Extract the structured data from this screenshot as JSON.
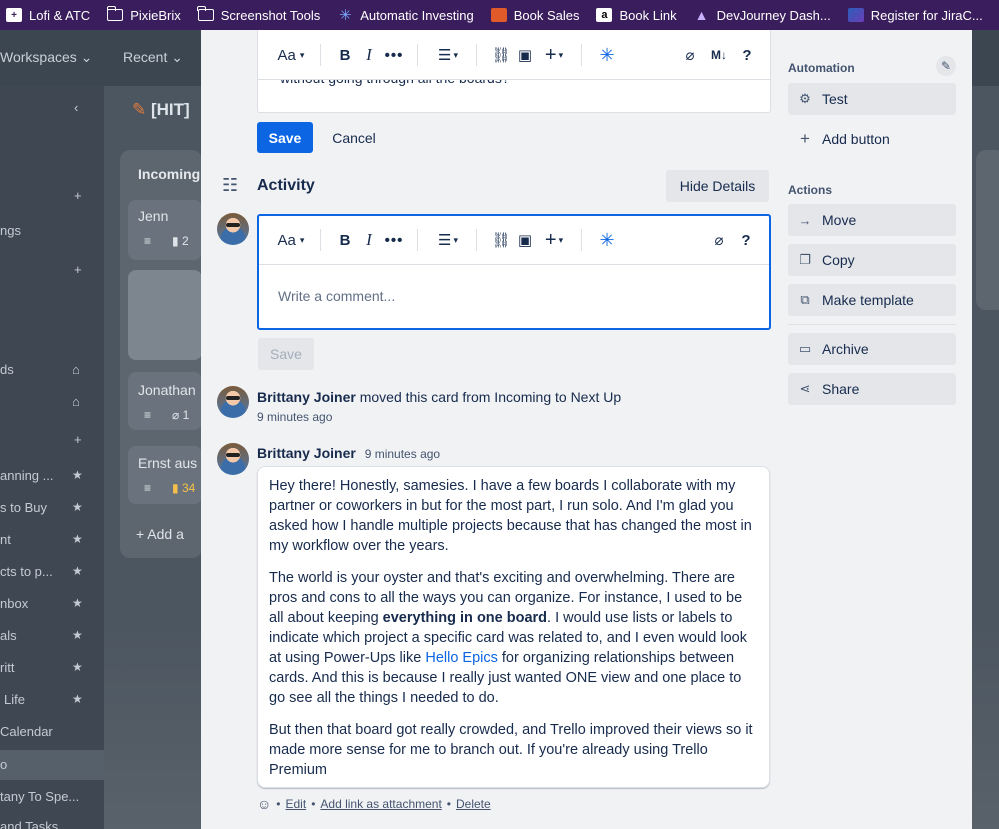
{
  "bookmarks": [
    {
      "label": "Lofi & ATC",
      "icon": "lofi-icon"
    },
    {
      "label": "PixieBrix",
      "icon": "folder-icon"
    },
    {
      "label": "Screenshot Tools",
      "icon": "folder-icon"
    },
    {
      "label": "Automatic Investing",
      "icon": "snowflake-icon"
    },
    {
      "label": "Book Sales",
      "icon": "book-icon"
    },
    {
      "label": "Book Link",
      "icon": "amazon-icon"
    },
    {
      "label": "DevJourney Dash...",
      "icon": "devjourney-icon"
    },
    {
      "label": "Register for JiraC...",
      "icon": "jira-icon"
    }
  ],
  "background": {
    "nav": {
      "workspaces": "Workspaces",
      "recent": "Recent"
    },
    "board_title": "[HIT]",
    "list_title": "Incoming",
    "cards": [
      "Jenn",
      "Jonathan",
      "Ernst aus"
    ],
    "card_badges": [
      "2",
      "1",
      "34"
    ],
    "add_card": "Add a",
    "sidebar_items": [
      "ngs",
      "ds",
      "anning ...",
      "s to Buy",
      "nt",
      "cts to p...",
      "nbox",
      "als",
      "ritt",
      "Life",
      "Calendar",
      "o",
      "tany To Spe...",
      "and Tasks"
    ]
  },
  "description_editor": {
    "partial_text": "without going through all the boards?",
    "save_label": "Save",
    "cancel_label": "Cancel"
  },
  "toolbar": {
    "text_style": "Aa",
    "bold": "B",
    "italic": "I",
    "more": "•••",
    "markdown": "M↓",
    "help": "?"
  },
  "activity": {
    "title": "Activity",
    "hide_details": "Hide Details",
    "comment_placeholder": "Write a comment...",
    "comment_save": "Save"
  },
  "activity_items": [
    {
      "user": "Brittany Joiner",
      "action": "moved this card from Incoming to Next Up",
      "time": "9 minutes ago"
    }
  ],
  "comment": {
    "user": "Brittany Joiner",
    "time": "9 minutes ago",
    "p1": "Hey there! Honestly, samesies. I have a few boards I collaborate with my partner or coworkers in but for the most part, I run solo. And I'm glad you asked how I handle multiple projects because that has changed the most in my workflow over the years.",
    "p2_a": "The world is your oyster and that's exciting and overwhelming. There are pros and cons to all the ways you can organize. For instance, I used to be all about keeping ",
    "p2_bold": "everything in one board",
    "p2_b": ". I would use lists or labels to indicate which project a specific card was related to, and I even would look at using Power-Ups like ",
    "p2_link": "Hello Epics",
    "p2_c": " for organizing relationships between cards. And this is because I really just wanted ONE view and one place to go see all the things I needed to do.",
    "p3": "But then that board got really crowded, and Trello improved their views so it made more sense for me to branch out. If you're already using Trello Premium",
    "edit": "Edit",
    "add_link": "Add link as attachment",
    "delete": "Delete",
    "dot": "•"
  },
  "sidebar": {
    "automation_label": "Automation",
    "test_button": "Test",
    "add_button": "Add button",
    "actions_label": "Actions",
    "move": "Move",
    "copy": "Copy",
    "make_template": "Make template",
    "archive": "Archive",
    "share": "Share"
  },
  "colors": {
    "primary": "#0c66e4",
    "bookmark_bar": "#3a1d5c",
    "modal_bg": "#f1f2f4"
  }
}
